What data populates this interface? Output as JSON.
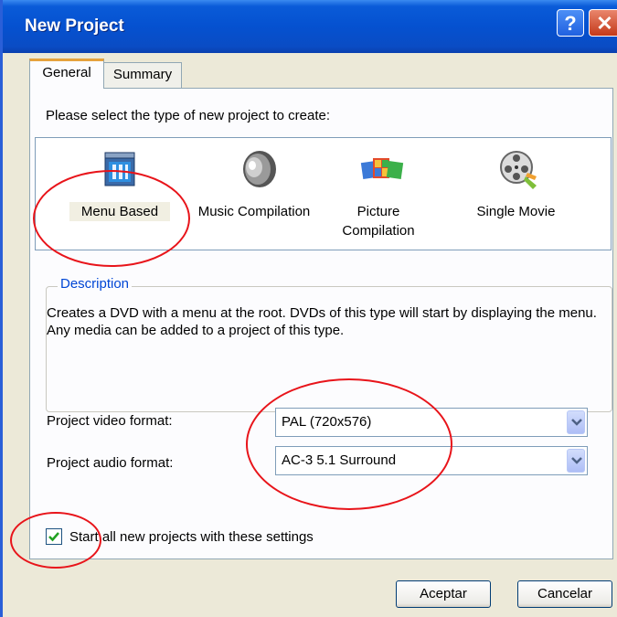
{
  "window": {
    "title": "New Project"
  },
  "tabs": [
    {
      "label": "General",
      "selected": true
    },
    {
      "label": "Summary",
      "selected": false
    }
  ],
  "prompt": "Please select the type of new project to create:",
  "project_types": [
    {
      "label": "Menu Based",
      "icon": "menu-based-icon",
      "selected": true
    },
    {
      "label": "Music Compilation",
      "icon": "speaker-icon",
      "selected": false
    },
    {
      "label_line1": "Picture",
      "label_line2": "Compilation",
      "icon": "pictures-icon",
      "selected": false
    },
    {
      "label": "Single Movie",
      "icon": "film-reel-icon",
      "selected": false
    }
  ],
  "description": {
    "legend": "Description",
    "text": "Creates a DVD with a menu at the root.  DVDs of this type will start by displaying the menu.  Any media can be added to a project of this type."
  },
  "video_format": {
    "label": "Project video format:",
    "value": "PAL (720x576)"
  },
  "audio_format": {
    "label": "Project audio format:",
    "value": "AC-3 5.1 Surround"
  },
  "start_checkbox": {
    "label": "Start all new projects with these settings",
    "checked": true
  },
  "buttons": {
    "ok": "Aceptar",
    "cancel": "Cancelar"
  },
  "colors": {
    "titlebar": "#0551d0",
    "annotation": "#e8141a",
    "legend_text": "#0046d5"
  }
}
